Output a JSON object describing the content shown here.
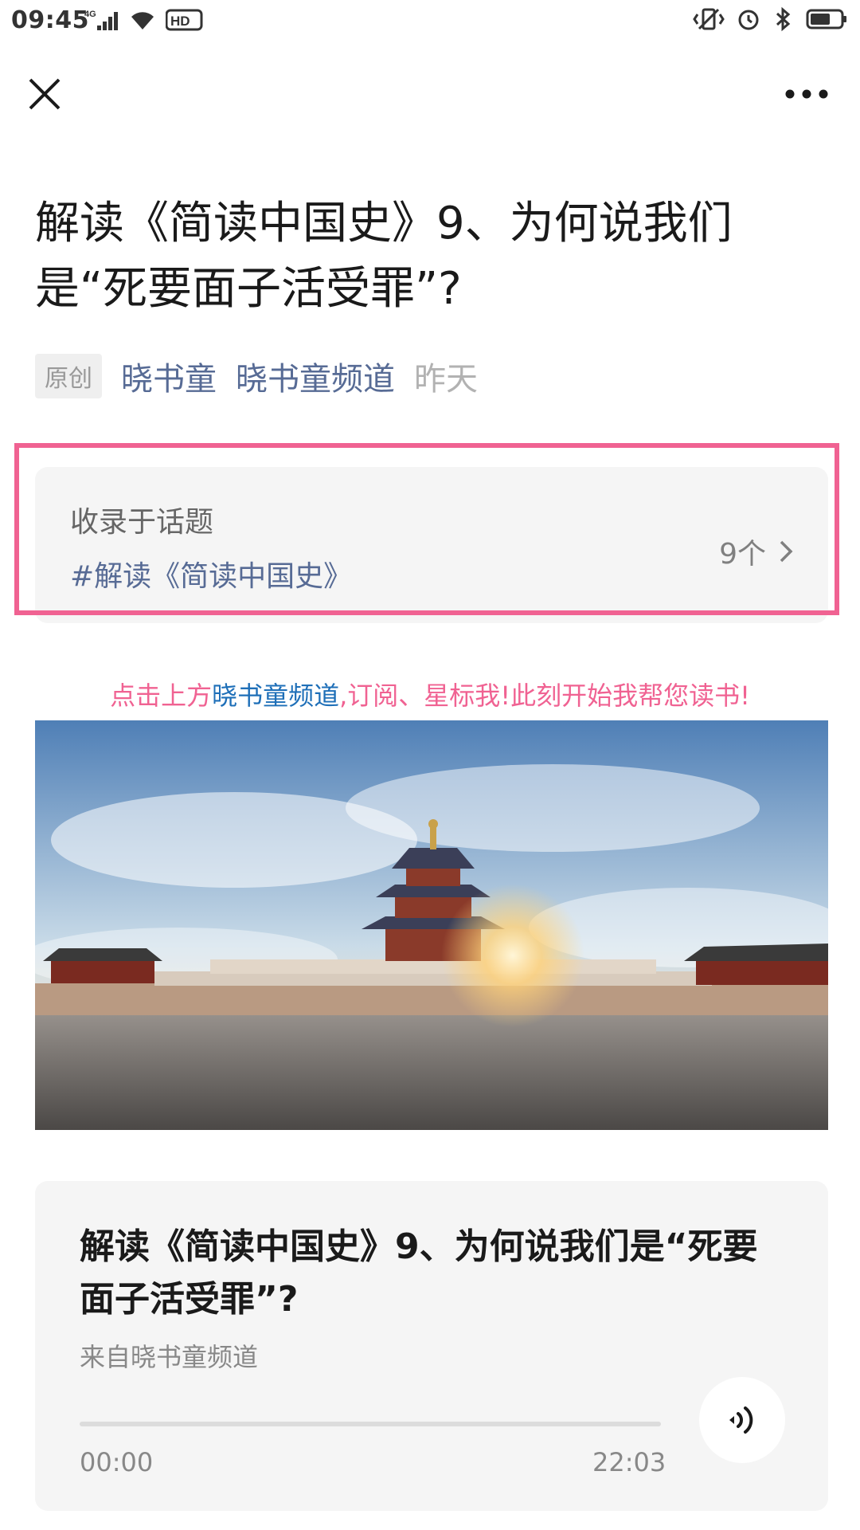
{
  "status_bar": {
    "time": "09:45",
    "network_label": "4G",
    "hd_label": "HD"
  },
  "nav": {
    "close_icon": "close-icon",
    "more_icon": "more-icon"
  },
  "article": {
    "title": "解读《简读中国史》9、为何说我们是“死要面子活受罪”?",
    "badge": "原创",
    "author": "晓书童",
    "channel": "晓书童频道",
    "date": "昨天"
  },
  "topic": {
    "label": "收录于话题",
    "name": "#解读《简读中国史》",
    "count": "9个"
  },
  "promo": {
    "before": "点击上方",
    "highlight": "晓书童频道",
    "after": ",订阅、星标我!此刻开始我帮您读书!"
  },
  "audio": {
    "title": "解读《简读中国史》9、为何说我们是“死要面子活受罪”?",
    "source": "来自晓书童频道",
    "current_time": "00:00",
    "total_time": "22:03",
    "progress": 0
  },
  "colors": {
    "link": "#576b95",
    "highlight_border": "#f06292",
    "promo_pink": "#f06292",
    "promo_blue": "#1e6fb8"
  }
}
